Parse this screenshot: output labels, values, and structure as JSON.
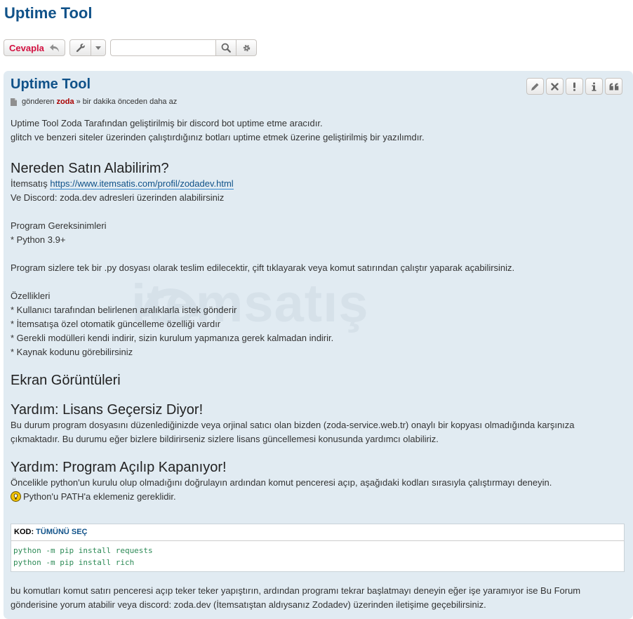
{
  "page": {
    "title": "Uptime Tool"
  },
  "action_bar": {
    "reply_label": "Cevapla",
    "search_placeholder": ""
  },
  "post": {
    "title": "Uptime Tool",
    "author_prefix": "gönderen",
    "author": "zoda",
    "time_separator": "»",
    "time": "bir dakika önceden daha az",
    "watermark": "itemsatış",
    "intro": [
      "Uptime Tool Zoda Tarafından geliştirilmiş bir discord bot uptime etme aracıdır.",
      "glitch ve benzeri siteler üzerinden çalıştırdığınız botları uptime etmek üzerine geliştirilmiş bir yazılımdır."
    ],
    "where_heading": "Nereden Satın Alabilirim?",
    "itemsatis_label": "İtemsatış",
    "itemsatis_link": "https://www.itemsatis.com/profil/zodadev.html",
    "discord_line": "Ve Discord: zoda.dev adresleri üzerinden alabilirsiniz",
    "requirements_title": "Program Gereksinimleri",
    "requirements": [
      "* Python 3.9+"
    ],
    "delivery_line": "Program sizlere tek bir .py dosyası olarak teslim edilecektir, çift tıklayarak veya komut satırından çalıştır yaparak açabilirsiniz.",
    "features_title": "Özellikleri",
    "features": [
      "* Kullanıcı tarafından belirlenen aralıklarla istek gönderir",
      "* İtemsatışa özel otomatik güncelleme özelliği vardır",
      "* Gerekli modülleri kendi indirir, sizin kurulum yapmanıza gerek kalmadan indirir.",
      "* Kaynak kodunu görebilirsiniz"
    ],
    "screenshots_heading": "Ekran Görüntüleri",
    "help1_heading": "Yardım: Lisans Geçersiz Diyor!",
    "help1_text": [
      "Bu durum program dosyasını düzenlediğinizde veya orjinal satıcı olan bizden (zoda-service.web.tr) onaylı bir kopyası olmadığında karşınıza",
      "çıkmaktadır. Bu durumu eğer bizlere bildirirseniz sizlere lisans güncellemesi konusunda yardımcı olabiliriz."
    ],
    "help2_heading": "Yardım: Program Açılıp Kapanıyor!",
    "help2_text": "Öncelikle python'un kurulu olup olmadığını doğrulayın ardından komut penceresi açıp, aşağıdaki kodları sırasıyla çalıştırmayı deneyin.",
    "help2_tip": "Python'u PATH'a eklemeniz gereklidir.",
    "code_label": "KOD:",
    "code_select_all": "TÜMÜNÜ SEÇ",
    "code_lines": [
      "python -m pip install requests",
      "python -m pip install rich"
    ],
    "closing": [
      "bu komutları komut satırı penceresi açıp teker teker yapıştırın, ardından programı tekrar başlatmayı deneyin eğer işe yaramıyor ise Bu Forum",
      "gönderisine yorum atabilir veya discord: zoda.dev (İtemsatıştan aldıysanız Zodadev) üzerinden iletişime geçebilirsiniz."
    ]
  },
  "icons": {
    "reply": "reply-arrow-icon",
    "tools": "wrench-icon",
    "dropdown": "caret-down-icon",
    "search": "search-icon",
    "advanced_search": "gear-icon",
    "post_actions": [
      "pencil-icon",
      "close-icon",
      "report-icon",
      "info-icon",
      "quote-icon"
    ],
    "tip": "lightbulb-icon"
  },
  "colors": {
    "title": "#105289",
    "reply_button": "#d31141",
    "post_background": "#e1ebf2",
    "author": "#aa0000",
    "code": "#2e8b57"
  }
}
